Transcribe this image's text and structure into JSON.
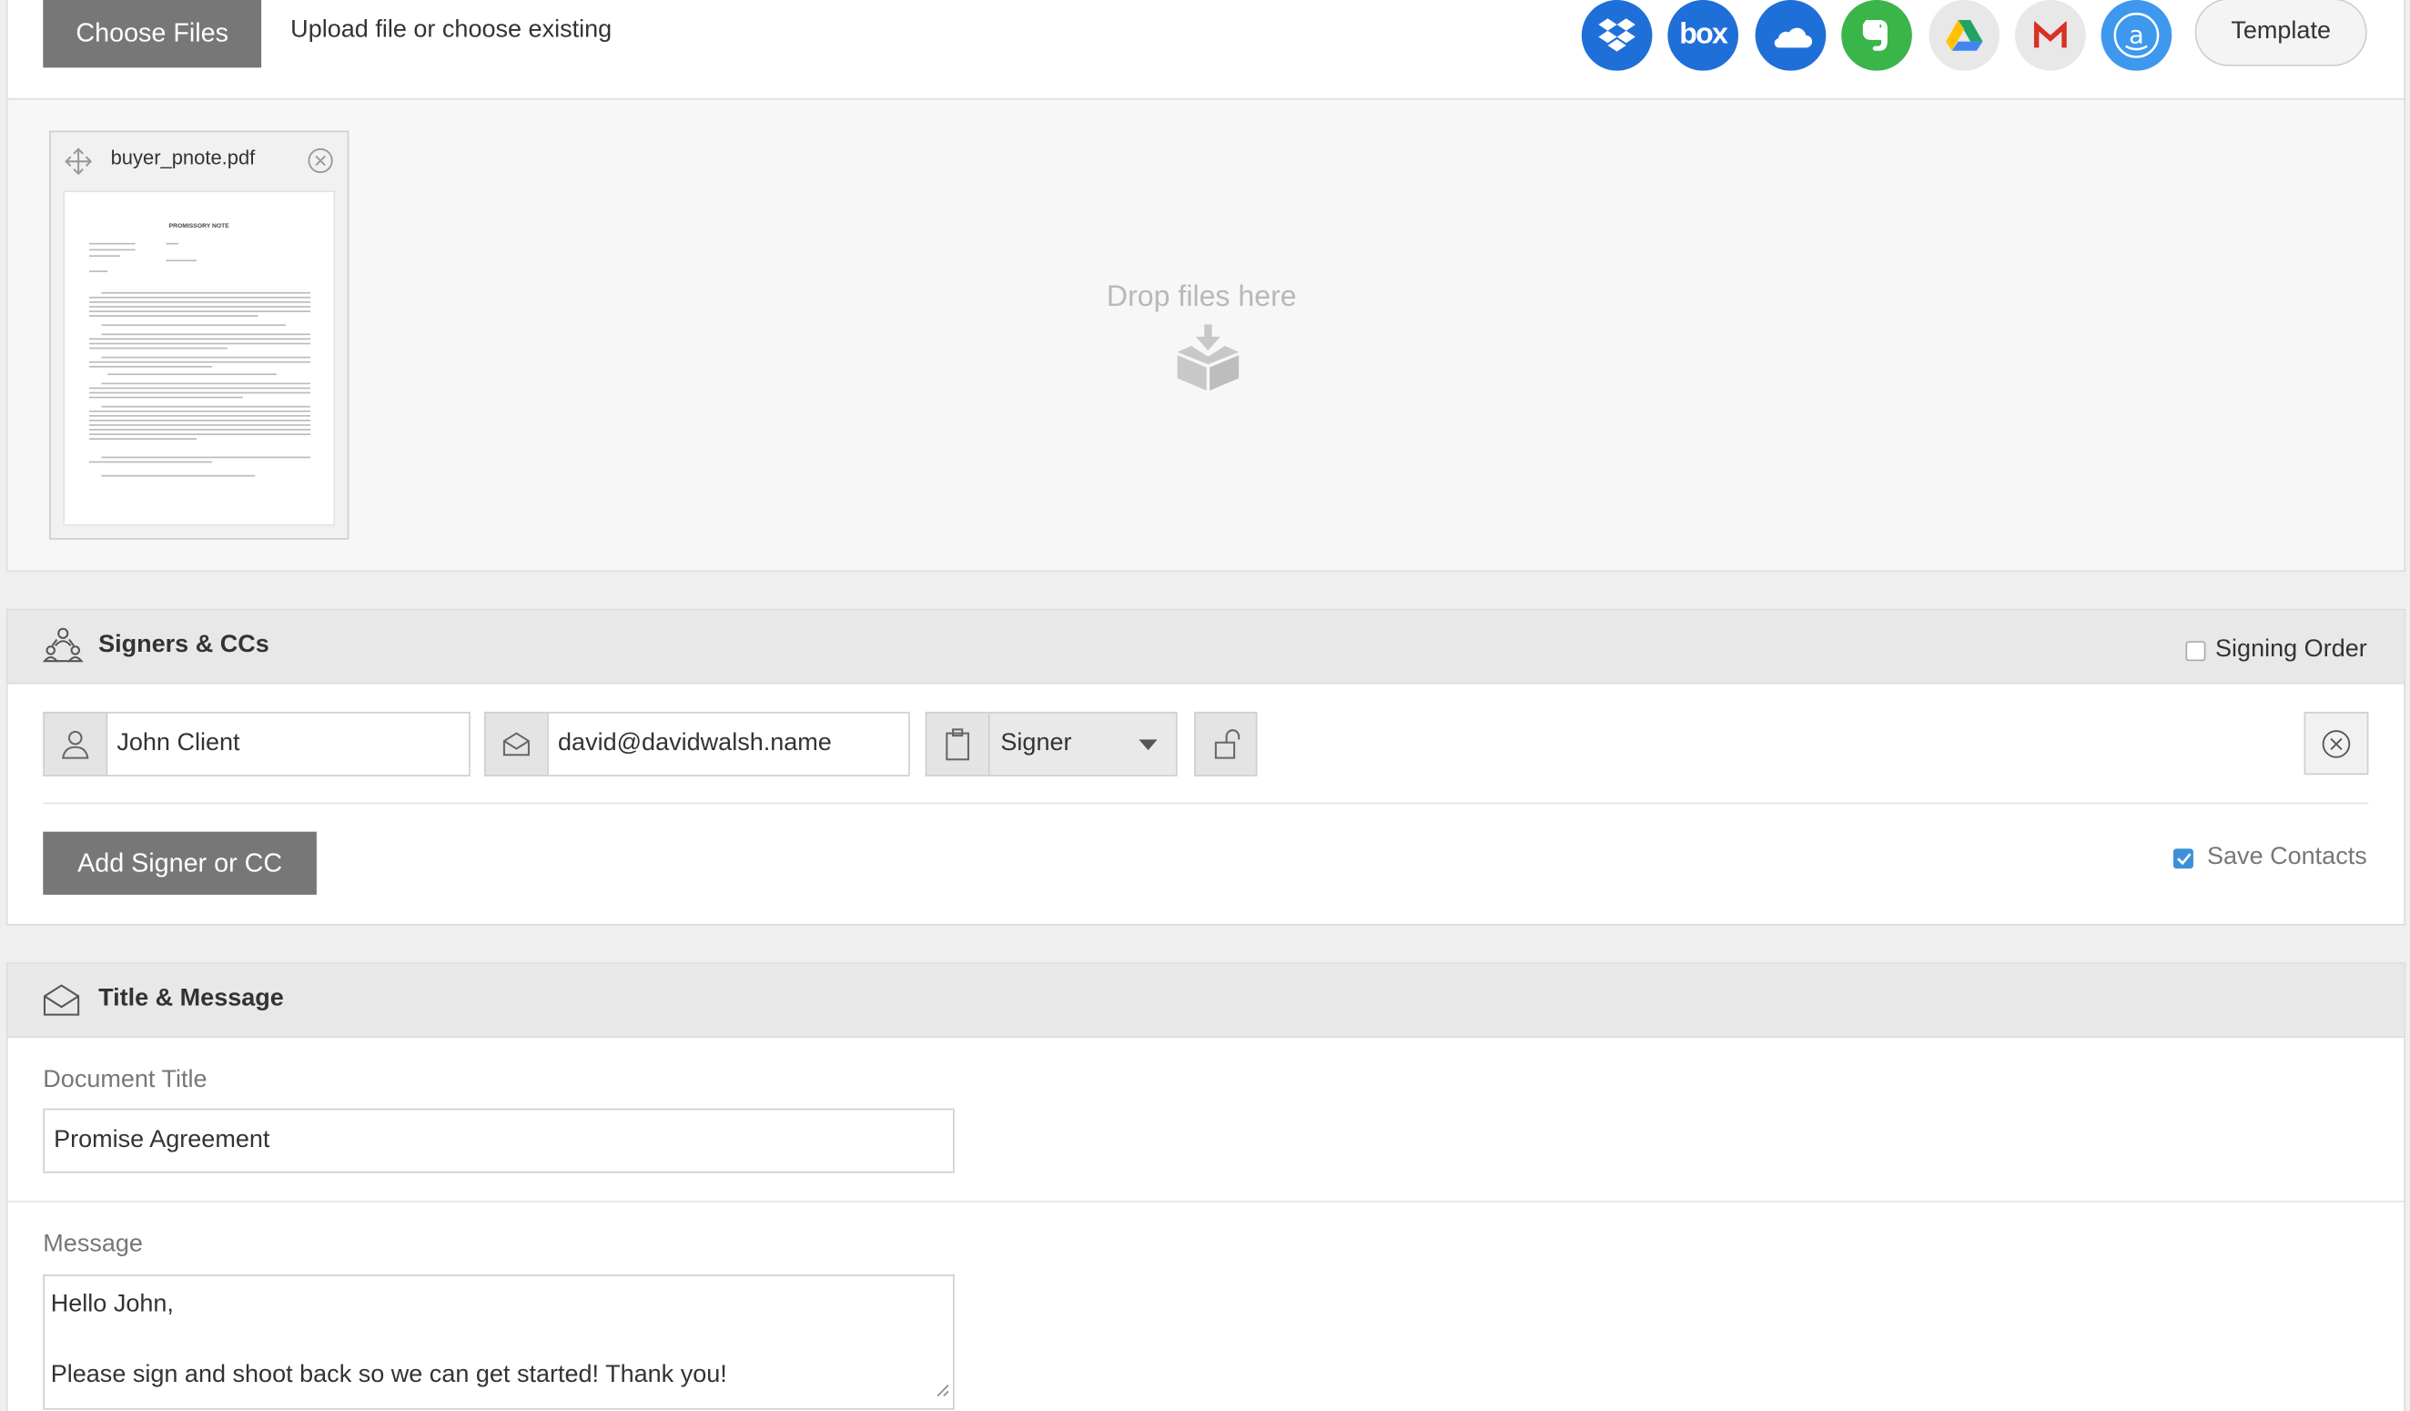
{
  "upload": {
    "choose_files_label": "Choose Files",
    "hint": "Upload file or choose existing",
    "template_label": "Template",
    "drop_text": "Drop files here",
    "cloud_services": [
      {
        "name": "dropbox-icon",
        "color": "#1f6fd8"
      },
      {
        "name": "box-icon",
        "color": "#1f6fd8",
        "text": "box"
      },
      {
        "name": "onedrive-icon",
        "color": "#1f6fd8"
      },
      {
        "name": "evernote-icon",
        "color": "#39b54a"
      },
      {
        "name": "google-drive-icon",
        "color": "#e8e8e8"
      },
      {
        "name": "gmail-icon",
        "color": "#e8e8e8"
      },
      {
        "name": "amazon-icon",
        "color": "#3d98ee"
      }
    ],
    "file": {
      "name": "buyer_pnote.pdf",
      "thumb_heading": "PROMISSORY NOTE"
    }
  },
  "signers": {
    "title": "Signers & CCs",
    "signing_order_label": "Signing Order",
    "signer_name": "John Client",
    "signer_email": "david@davidwalsh.name",
    "role": "Signer",
    "add_label": "Add Signer or CC",
    "save_contacts_label": "Save Contacts"
  },
  "title_message": {
    "title": "Title & Message",
    "doc_title_label": "Document Title",
    "doc_title_value": "Promise Agreement",
    "message_label": "Message",
    "message_lines": [
      "Hello John,",
      "",
      "Please sign and shoot back so we can get started! Thank you!"
    ]
  },
  "colors": {
    "accent": "#3d8fd8",
    "button_gray": "#777777"
  }
}
